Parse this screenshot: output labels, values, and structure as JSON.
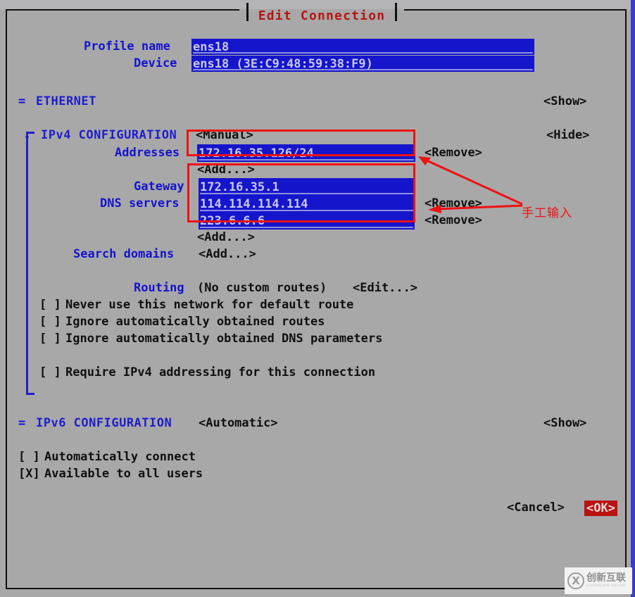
{
  "window": {
    "title": "Edit Connection",
    "title_color": "#b81414",
    "background": "#a8a8a8"
  },
  "form": {
    "profile_name": {
      "label": "Profile name",
      "value": "ens18"
    },
    "device": {
      "label": "Device",
      "value": "ens18 (3E:C9:48:59:38:F9)"
    }
  },
  "sections": {
    "ethernet": {
      "marker": "=",
      "title": "ETHERNET",
      "toggle_label": "<Show>"
    },
    "ipv4": {
      "marker": "-",
      "title": "IPv4 CONFIGURATION",
      "method": "<Manual>",
      "toggle_label": "<Hide>",
      "addresses": {
        "label": "Addresses",
        "entries": [
          {
            "value": "172.16.35.126/24",
            "remove_label": "<Remove>"
          }
        ],
        "add_label": "<Add...>"
      },
      "gateway": {
        "label": "Gateway",
        "value": "172.16.35.1"
      },
      "dns_servers": {
        "label": "DNS servers",
        "entries": [
          {
            "value": "114.114.114.114",
            "remove_label": "<Remove>"
          },
          {
            "value": "223.6.6.6",
            "remove_label": "<Remove>"
          }
        ],
        "add_label": "<Add...>"
      },
      "search_domains": {
        "label": "Search domains",
        "add_label": "<Add...>"
      },
      "routing": {
        "label": "Routing",
        "status": "(No custom routes)",
        "edit_label": "<Edit...>"
      },
      "checkboxes": [
        {
          "mark": "[ ]",
          "checked": false,
          "label": "Never use this network for default route"
        },
        {
          "mark": "[ ]",
          "checked": false,
          "label": "Ignore automatically obtained routes"
        },
        {
          "mark": "[ ]",
          "checked": false,
          "label": "Ignore automatically obtained DNS parameters"
        }
      ],
      "require_ipv4": {
        "mark": "[ ]",
        "checked": false,
        "label": "Require IPv4 addressing for this connection"
      }
    },
    "ipv6": {
      "marker": "=",
      "title": "IPv6 CONFIGURATION",
      "method": "<Automatic>",
      "toggle_label": "<Show>"
    }
  },
  "global_options": [
    {
      "mark": "[ ]",
      "checked": false,
      "label": "Automatically connect"
    },
    {
      "mark": "[X]",
      "checked": true,
      "label": "Available to all users"
    }
  ],
  "buttons": {
    "cancel": "<Cancel>",
    "ok": "<OK>",
    "ok_bg": "#bb1111"
  },
  "annotation": {
    "note": "手工输入",
    "color": "#ee1111"
  },
  "watermark": {
    "logo": "X",
    "cn": "创新互联",
    "en": "CHUANGXIN HULIAN"
  }
}
